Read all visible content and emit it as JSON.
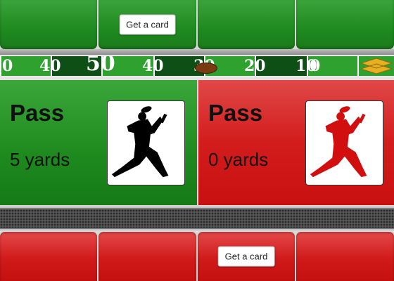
{
  "opponent_row": {
    "get_card_label": "Get a card"
  },
  "player_row": {
    "get_card_label": "Get a card"
  },
  "field": {
    "yard_numbers": [
      "0",
      "40",
      "50",
      "40",
      "30",
      "20",
      "10"
    ],
    "left_end_number": "0"
  },
  "left_panel": {
    "play": "Pass",
    "yards": "5 yards",
    "color": "#1e8a1e",
    "icon": "receiver-silhouette-icon"
  },
  "right_panel": {
    "play": "Pass",
    "yards": "0 yards",
    "color": "#d31c1c",
    "icon": "receiver-silhouette-icon"
  }
}
